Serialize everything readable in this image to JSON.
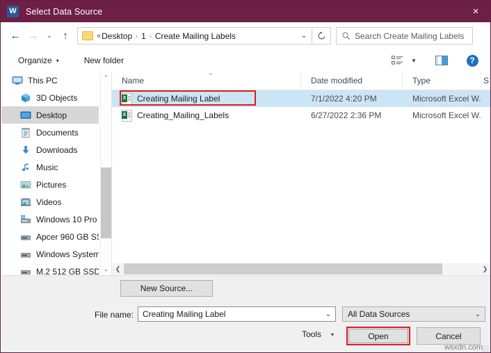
{
  "window": {
    "title": "Select Data Source",
    "app_icon": "word-icon",
    "close_icon": "×",
    "titlebar_color": "#6d1f45"
  },
  "nav": {
    "back_icon": "←",
    "forward_icon": "→",
    "recent_icon": "⌄",
    "up_icon": "↑",
    "refresh_icon": "↻",
    "address_chevrons": "«",
    "breadcrumb": [
      "Desktop",
      "1",
      "Create Mailing Labels"
    ],
    "breadcrumb_separator": "›",
    "address_dropdown_icon": "⌄"
  },
  "search": {
    "icon": "search-icon",
    "placeholder": "Search Create Mailing Labels"
  },
  "toolbar": {
    "organize_label": "Organize",
    "organize_caret": "▾",
    "new_folder_label": "New folder",
    "view_icon": "view-list-icon",
    "view_caret": "▾",
    "preview_pane_icon": "preview-pane-icon",
    "help_label": "?"
  },
  "sidebar": {
    "items": [
      {
        "label": "This PC",
        "icon": "pc-icon",
        "indent": false,
        "selected": false
      },
      {
        "label": "3D Objects",
        "icon": "cube-icon",
        "indent": true,
        "selected": false
      },
      {
        "label": "Desktop",
        "icon": "desktop-icon",
        "indent": true,
        "selected": true
      },
      {
        "label": "Documents",
        "icon": "documents-icon",
        "indent": true,
        "selected": false
      },
      {
        "label": "Downloads",
        "icon": "downloads-icon",
        "indent": true,
        "selected": false
      },
      {
        "label": "Music",
        "icon": "music-icon",
        "indent": true,
        "selected": false
      },
      {
        "label": "Pictures",
        "icon": "pictures-icon",
        "indent": true,
        "selected": false
      },
      {
        "label": "Videos",
        "icon": "videos-icon",
        "indent": true,
        "selected": false
      },
      {
        "label": "Windows 10 Pro",
        "icon": "drive-system-icon",
        "indent": true,
        "selected": false
      },
      {
        "label": "Apcer 960 GB SS",
        "icon": "drive-icon",
        "indent": true,
        "selected": false
      },
      {
        "label": "Windows System",
        "icon": "drive-icon",
        "indent": true,
        "selected": false
      },
      {
        "label": "M.2 512 GB SSD",
        "icon": "drive-icon",
        "indent": true,
        "selected": false
      }
    ],
    "scroll_up_icon": "⌃",
    "scroll_down_icon": "⌄"
  },
  "filelist": {
    "columns": [
      "Name",
      "Date modified",
      "Type",
      "S"
    ],
    "sort_caret": "⌃",
    "rows": [
      {
        "name": "Creating Mailing Label",
        "date": "7/1/2022 4:20 PM",
        "type": "Microsoft Excel W...",
        "icon": "excel-file-icon",
        "selected": true,
        "highlighted": true
      },
      {
        "name": "Creating_Mailing_Labels",
        "date": "6/27/2022 2:36 PM",
        "type": "Microsoft Excel W...",
        "icon": "excel-file-icon",
        "selected": false,
        "highlighted": false
      }
    ],
    "hscroll_left_icon": "❮",
    "hscroll_right_icon": "❯"
  },
  "bottom": {
    "new_source_label": "New Source...",
    "file_name_label": "File name:",
    "file_name_value": "Creating Mailing Label",
    "file_name_dropdown_icon": "⌄",
    "filter_value": "All Data Sources",
    "filter_dropdown_icon": "⌄",
    "tools_label": "Tools",
    "tools_caret": "▾",
    "open_label": "Open",
    "cancel_label": "Cancel"
  },
  "watermark": "wsxdn.com",
  "accents": {
    "highlight_red": "#e01b1b",
    "selection_blue": "#cce5f6",
    "help_blue": "#1d6fc0"
  }
}
